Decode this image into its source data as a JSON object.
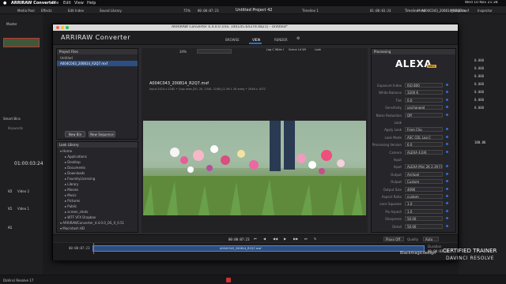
{
  "menubar": {
    "app": "ARRIRAW Converter",
    "items": [
      "File",
      "Edit",
      "View",
      "Help"
    ],
    "clock": "Wed 10 Nov 21:38"
  },
  "resolve_toolbar": {
    "left": [
      "Media Pool",
      "Effects",
      "Edit Index",
      "Sound Library"
    ],
    "zoom": "75%",
    "timecode": "00:00:07:23",
    "project": "Untitled Project 42",
    "timeline": "Timeline 1",
    "tc2": "01:00:03:24",
    "right_title": "Timeline - A004C043_200814_R2Q7.mxf",
    "right": [
      "Mixer",
      "Metadata",
      "Inspector"
    ]
  },
  "resolve_left": {
    "master": "Master",
    "smart_bins": "Smart Bins",
    "keywords": "Keywords",
    "timecode": "01:00:03:24",
    "tracks": [
      {
        "id": "V2",
        "name": "Video 2"
      },
      {
        "id": "V1",
        "name": "Video 1"
      },
      {
        "id": "A1",
        "name": ""
      }
    ],
    "footer": "DaVinci Resolve 17"
  },
  "window": {
    "title": "ARRIRAW Converter 4.4.0.0 (rev. 140145.64379.4821) - Untitled*",
    "logo": "ARRIRAW Converter",
    "tabs": [
      "BROWSE",
      "VIEW",
      "RENDER"
    ]
  },
  "project_files": {
    "header": "Project Files",
    "items": [
      "Untitled",
      "A004C043_200814_R2Q7.mxf"
    ],
    "new_bin": "New Bin",
    "new_sequence": "New Sequence"
  },
  "look_library": {
    "header": "Look Library",
    "items": [
      "Home",
      "Applications",
      "Desktop",
      "Documents",
      "Downloads",
      "FoundryLicensing",
      "Library",
      "Movies",
      "Music",
      "Pictures",
      "Public",
      "screen_shots",
      "WTF VFX Dropbox",
      "ARRIRAWConverter_4.4.0.0_OS_X_0.51",
      "Macintosh HD"
    ]
  },
  "viewer": {
    "zoom": "34%",
    "filename": "A004C043_200814_R2Q7.mxf",
    "info": "Input 2424 x 2262 • Crop area [20, 20, 2340, 2248] (2.39:1 2K area) • 2048 x 1072",
    "toggles": [
      "Log C Wide Gamut",
      "Scene Lit White",
      "Look"
    ],
    "timecode": "00:00:07:23",
    "frame_end": "00:00:03:24",
    "timeline_clip": "A004C043_200814_R2Q7.mxf",
    "duration_label": "Duration",
    "duration": "00:00:03:24"
  },
  "processing": {
    "header": "Processing",
    "brand": "ALEXA",
    "badge": "mini",
    "params": [
      {
        "label": "Exposure Index",
        "value": "ISO 800"
      },
      {
        "label": "White Balance",
        "value": "3200 K"
      },
      {
        "label": "Tint",
        "value": "0.0"
      },
      {
        "label": "Sensitivity",
        "value": "unchanged"
      },
      {
        "label": "Noise Reduction",
        "value": "Off"
      },
      {
        "label": "Look",
        "value": ""
      },
      {
        "label": "Apply Look",
        "value": "From Clip"
      },
      {
        "label": "Look Mode",
        "value": "ASC CDL Log C"
      },
      {
        "label": "Processing Version",
        "value": "6.0"
      },
      {
        "label": "Camera",
        "value": "ALEXA 4.0/6"
      },
      {
        "label": "Input",
        "value": ""
      },
      {
        "label": "Input",
        "value": "ALEXA Mini 2K 2.39 Flex"
      },
      {
        "label": "Output",
        "value": "Archpel"
      },
      {
        "label": "Output",
        "value": "Custom"
      },
      {
        "label": "Output Size",
        "value": "4096"
      },
      {
        "label": "Aspect Ratio",
        "value": "custom"
      },
      {
        "label": "Lens Squeeze",
        "value": "1.0"
      },
      {
        "label": "Pix Aspect",
        "value": "1.0"
      },
      {
        "label": "Sharpness",
        "value": "50.00"
      },
      {
        "label": "Detail",
        "value": "50.00"
      }
    ],
    "preset": "Proxy Off",
    "quality_label": "Quality",
    "quality": "Auto"
  },
  "inspector": {
    "zoom": "100.00",
    "right_values": [
      "0.000",
      "0.000",
      "0.000",
      "0.000",
      "0.000",
      "0.000",
      "0.000"
    ]
  },
  "watermark": {
    "brand": "Blackmagicdesign",
    "line1": "CERTIFIED TRAINER",
    "line2": "DAVINCI RESOLVE"
  },
  "colors": {
    "accent": "#2b6fd6",
    "bg": "#1b1b1e",
    "panel": "#26262a"
  }
}
